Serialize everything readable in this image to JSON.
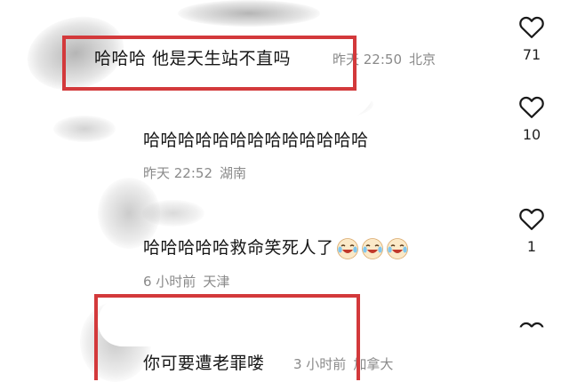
{
  "comments": [
    {
      "text": "哈哈哈 他是天生站不直吗",
      "time": "昨天 22:50",
      "location": "北京",
      "likes": "71"
    },
    {
      "text": "哈哈哈哈哈哈哈哈哈哈哈哈哈",
      "time": "昨天 22:52",
      "location": "湖南",
      "likes": "10"
    },
    {
      "text": "哈哈哈哈哈救命笑死人了",
      "time": "6 小时前",
      "location": "天津",
      "likes": "1",
      "emoji_count": 3
    },
    {
      "text": "你可要遭老罪喽",
      "time": "3 小时前",
      "location": "加拿大"
    }
  ],
  "colors": {
    "highlight": "#d3393b",
    "meta": "#8a8a8a",
    "text": "#161616"
  },
  "icons": {
    "like": "heart-outline-icon",
    "emoji": "crying-laughing-face-icon"
  }
}
